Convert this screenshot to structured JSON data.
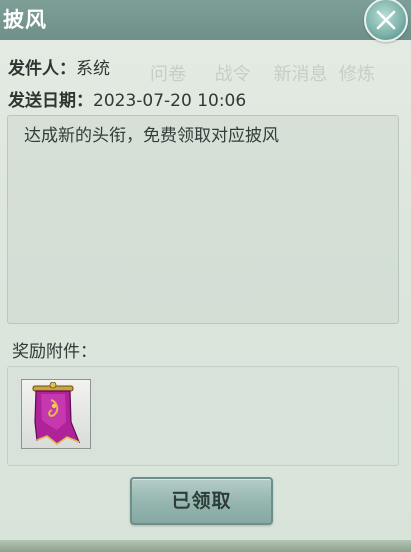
{
  "window": {
    "title": "披风"
  },
  "close_button": {
    "icon": "close-icon"
  },
  "mail": {
    "sender_label": "发件人：",
    "sender_value": "系统",
    "date_label": "发送日期：",
    "date_value": "2023-07-20 10:06",
    "body": "达成新的头衔，免费领取对应披风"
  },
  "attachments": {
    "label": "奖励附件：",
    "items": [
      {
        "icon": "cape-item-icon"
      }
    ]
  },
  "claim_button": {
    "label": "已领取"
  },
  "colors": {
    "title_bar": "#7e9e98",
    "panel_bg": "#e4ebe3",
    "button_bg": "#97b7b1",
    "cape_purple": "#b0229a"
  }
}
